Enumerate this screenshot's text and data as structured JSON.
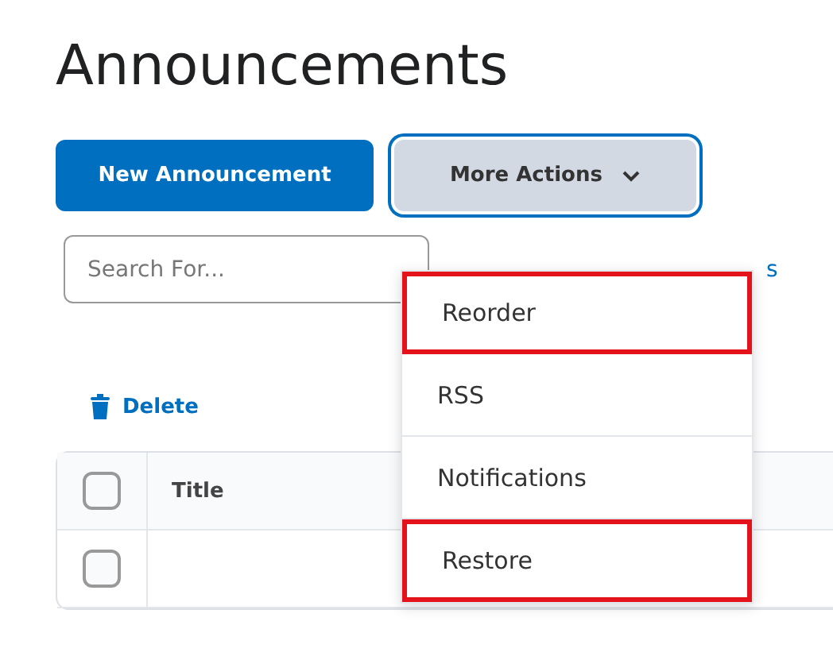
{
  "page_title": "Announcements",
  "buttons": [
    {
      "label": "New Announcement",
      "kind": "primary"
    },
    {
      "label": "More Actions",
      "kind": "menu",
      "expanded": true
    }
  ],
  "search": {
    "placeholder": "Search For..."
  },
  "search_link_partial": "s",
  "delete_action": {
    "label": "Delete"
  },
  "table": {
    "columns": [
      {
        "label": "Title"
      }
    ],
    "header_checkbox": {
      "checked": false
    },
    "rows": [
      {
        "checked": false
      }
    ]
  },
  "menu": {
    "items": [
      {
        "label": "Reorder",
        "highlighted": true
      },
      {
        "label": "RSS",
        "highlighted": false
      },
      {
        "label": "Notifications",
        "highlighted": false
      },
      {
        "label": "Restore",
        "highlighted": true
      }
    ]
  }
}
